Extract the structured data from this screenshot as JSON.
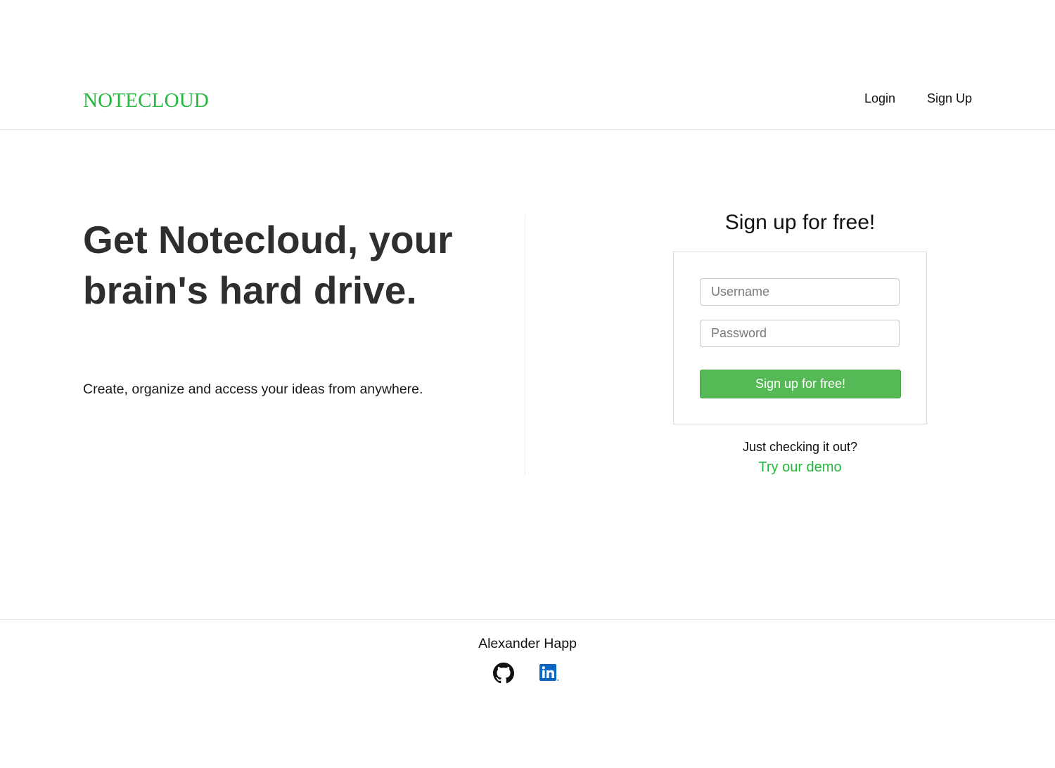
{
  "header": {
    "brand": "NOTECLOUD",
    "nav": {
      "login": "Login",
      "signup": "Sign Up"
    }
  },
  "hero": {
    "title": "Get Notecloud, your brain's hard drive.",
    "subtitle": "Create, organize and access your ideas from anywhere."
  },
  "signup": {
    "heading": "Sign up for free!",
    "username_placeholder": "Username",
    "password_placeholder": "Password",
    "submit_label": "Sign up for free!",
    "demo_prompt": "Just checking it out?",
    "demo_link": "Try our demo"
  },
  "footer": {
    "author": "Alexander Happ",
    "icons": [
      "github-icon",
      "linkedin-icon"
    ]
  },
  "colors": {
    "brand": "#22b83a",
    "button": "#55b955",
    "linkedin": "#0a66c2"
  }
}
